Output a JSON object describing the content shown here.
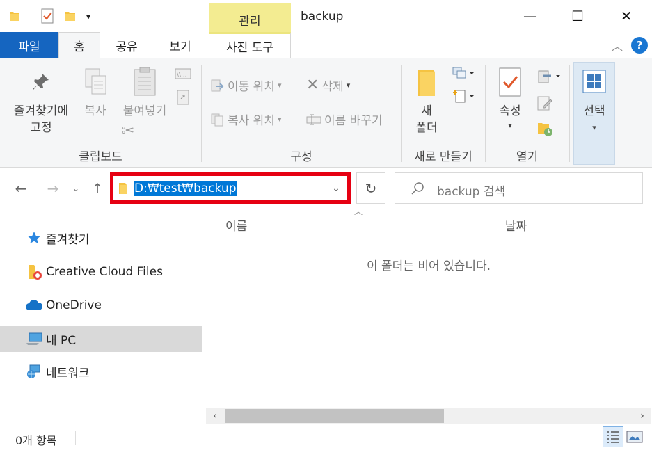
{
  "titlebar": {
    "context_tab": "관리",
    "window_title": "backup",
    "qat_icons": [
      "folder-icon",
      "properties-icon",
      "new-folder-icon",
      "customize-dropdown-icon"
    ],
    "buttons": {
      "minimize": "—",
      "maximize": "☐",
      "close": "✕"
    }
  },
  "tabs": {
    "file": "파일",
    "home": "홈",
    "share": "공유",
    "view": "보기",
    "picture_tools": "사진 도구"
  },
  "ribbon": {
    "clipboard": {
      "group_label": "클립보드",
      "pin_label_1": "즐겨찾기에",
      "pin_label_2": "고정",
      "copy_label": "복사",
      "paste_label": "붙여넣기"
    },
    "organize": {
      "group_label": "구성",
      "move_to": "이동 위치",
      "copy_to": "복사 위치",
      "delete": "삭제",
      "rename": "이름 바꾸기"
    },
    "new": {
      "group_label": "새로 만들기",
      "new_folder_1": "새",
      "new_folder_2": "폴더"
    },
    "open": {
      "group_label": "열기",
      "properties": "속성"
    },
    "select": {
      "label": "선택"
    }
  },
  "address": {
    "path": "D:₩test₩backup",
    "search_placeholder": "backup 검색"
  },
  "navpane": {
    "items": [
      {
        "label": "즐겨찾기",
        "icon": "star-icon"
      },
      {
        "label": "Creative Cloud Files",
        "icon": "creative-cloud-folder-icon"
      },
      {
        "label": "OneDrive",
        "icon": "cloud-icon"
      },
      {
        "label": "내 PC",
        "icon": "computer-icon"
      },
      {
        "label": "네트워크",
        "icon": "network-icon"
      }
    ]
  },
  "content": {
    "col_name": "이름",
    "col_date": "날짜",
    "empty_message": "이 폴더는 비어 있습니다."
  },
  "status": {
    "item_count": "0개 항목"
  },
  "colors": {
    "file_tab": "#1565c0",
    "context_band": "#f3ec91",
    "highlight_box": "#e60012",
    "selection": "#0078d7"
  }
}
